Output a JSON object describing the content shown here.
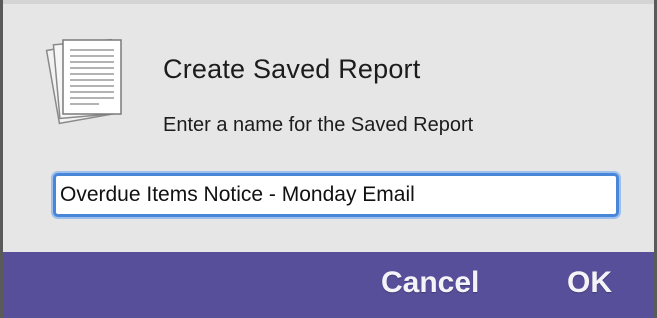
{
  "dialog": {
    "title": "Create Saved Report",
    "subtitle": "Enter a name for the Saved Report",
    "icon": "document-stack-icon",
    "name_input": {
      "value": "Overdue Items Notice - Monday Email"
    }
  },
  "buttons": {
    "cancel_label": "Cancel",
    "ok_label": "OK"
  },
  "colors": {
    "dialog_background": "#e6e6e6",
    "footer_bar": "#574f9a",
    "input_focus_ring": "#4a86d8"
  }
}
